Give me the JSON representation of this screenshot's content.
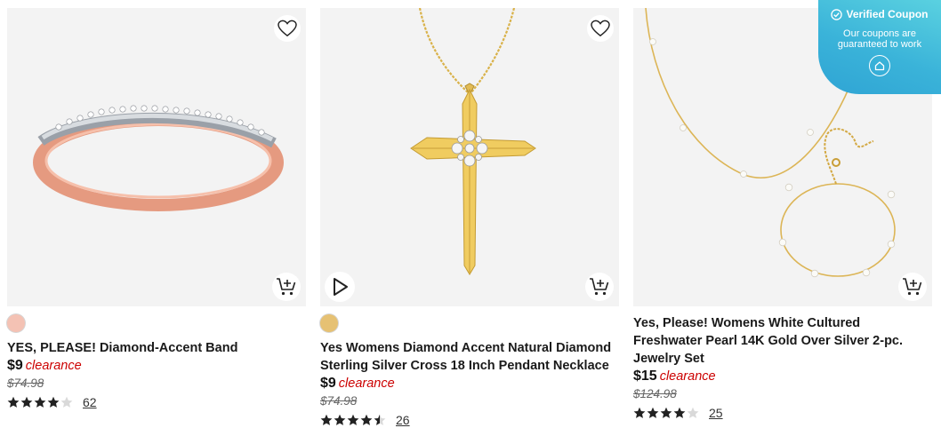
{
  "products": [
    {
      "title": "YES, PLEASE! Diamond-Accent Band",
      "price": "$9",
      "price_tag": "clearance",
      "original_price": "$74.98",
      "rating": 4.0,
      "review_count": "62",
      "swatch_color": "#f4c2b4",
      "image": "rose-gold-diamond-band-image"
    },
    {
      "title": "Yes Womens Diamond Accent Natural Diamond Sterling Silver Cross 18 Inch Pendant Necklace",
      "price": "$9",
      "price_tag": "clearance",
      "original_price": "$74.98",
      "rating": 4.5,
      "review_count": "26",
      "swatch_color": "#e6c173",
      "image": "gold-cross-pendant-image"
    },
    {
      "title": "Yes, Please! Womens White Cultured Freshwater Pearl 14K Gold Over Silver 2-pc. Jewelry Set",
      "price": "$15",
      "price_tag": "clearance",
      "original_price": "$124.98",
      "rating": 4.0,
      "review_count": "25",
      "image": "pearl-necklace-bracelet-set-image"
    }
  ],
  "coupon": {
    "title": "Verified Coupon",
    "message": "Our coupons are guaranteed to work"
  },
  "colors": {
    "clearance": "#cc0000",
    "star": "#222222",
    "star_empty": "#d9d9d9",
    "image_bg": "#f3f3f3"
  },
  "icons": {
    "favorite": "heart-outline-icon",
    "add_to_cart": "cart-plus-icon",
    "video": "play-icon",
    "coupon_verified": "check-circle-icon",
    "coupon_badge": "house-badge-icon"
  }
}
